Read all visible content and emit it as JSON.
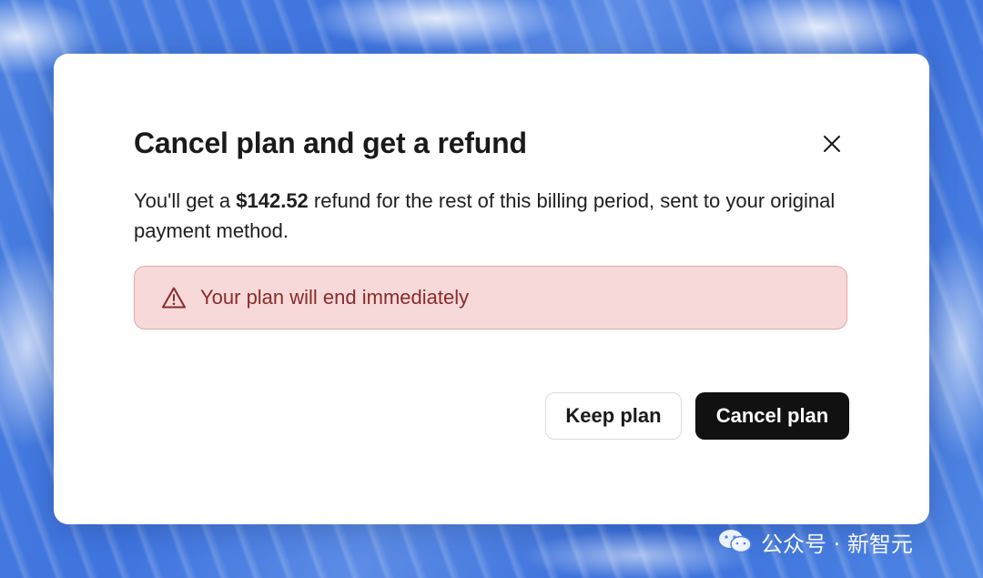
{
  "dialog": {
    "title": "Cancel plan and get a refund",
    "close_icon": "close-icon",
    "description_prefix": "You'll get a ",
    "refund_amount": "$142.52",
    "description_suffix": " refund for the rest of this billing period, sent to your original payment method.",
    "alert": {
      "icon": "warning-triangle-icon",
      "text": "Your plan will end immediately"
    },
    "buttons": {
      "keep_label": "Keep plan",
      "cancel_label": "Cancel plan"
    }
  },
  "watermark": {
    "icon": "wechat-icon",
    "text": "公众号 · 新智元"
  },
  "colors": {
    "background_blue": "#4a7fe0",
    "alert_background": "#f7d9d9",
    "alert_border": "#e3a6a6",
    "alert_text": "#8a2b2b",
    "primary_button": "#111111"
  }
}
